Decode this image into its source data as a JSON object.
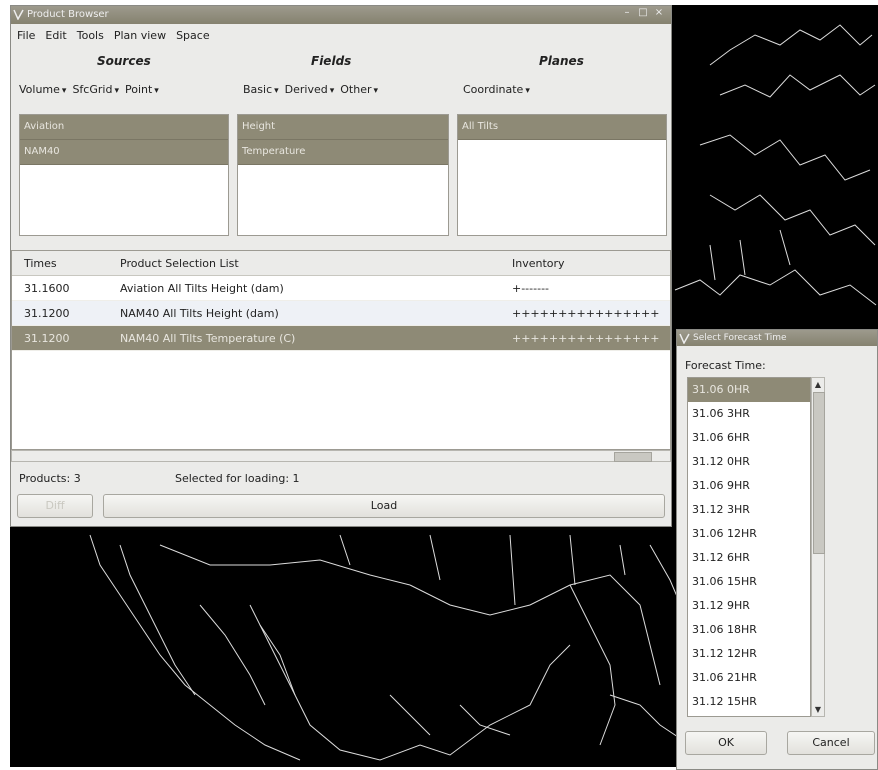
{
  "main_window": {
    "title": "Product Browser",
    "menu": [
      "File",
      "Edit",
      "Tools",
      "Plan view",
      "Space"
    ],
    "sections": {
      "sources": "Sources",
      "fields": "Fields",
      "planes": "Planes"
    },
    "source_dropdowns": [
      "Volume",
      "SfcGrid",
      "Point"
    ],
    "field_dropdowns": [
      "Basic",
      "Derived",
      "Other"
    ],
    "plane_dropdowns": [
      "Coordinate"
    ],
    "sources": [
      "Aviation",
      "NAM40"
    ],
    "fields": [
      "Height",
      "Temperature"
    ],
    "planes": [
      "All Tilts"
    ],
    "table": {
      "headers": {
        "times": "Times",
        "product": "Product Selection List",
        "inventory": "Inventory"
      },
      "rows": [
        {
          "time": "31.1600",
          "product": "Aviation All Tilts Height (dam)",
          "inventory": "+-------"
        },
        {
          "time": "31.1200",
          "product": "NAM40 All Tilts Height (dam)",
          "inventory": "++++++++++++++++"
        },
        {
          "time": "31.1200",
          "product": "NAM40 All Tilts Temperature (C)",
          "inventory": "++++++++++++++++"
        }
      ]
    },
    "status": {
      "products": "Products:  3",
      "selected": "Selected for loading:  1"
    },
    "buttons": {
      "diff": "Diff",
      "load": "Load"
    }
  },
  "forecast_dialog": {
    "title": "Select Forecast Time",
    "label": "Forecast Time:",
    "times": [
      "31.06 0HR",
      "31.06 3HR",
      "31.06 6HR",
      "31.12 0HR",
      "31.06 9HR",
      "31.12 3HR",
      "31.06 12HR",
      "31.12 6HR",
      "31.06 15HR",
      "31.12 9HR",
      "31.06 18HR",
      "31.12 12HR",
      "31.06 21HR",
      "31.12 15HR"
    ],
    "ok": "OK",
    "cancel": "Cancel"
  }
}
